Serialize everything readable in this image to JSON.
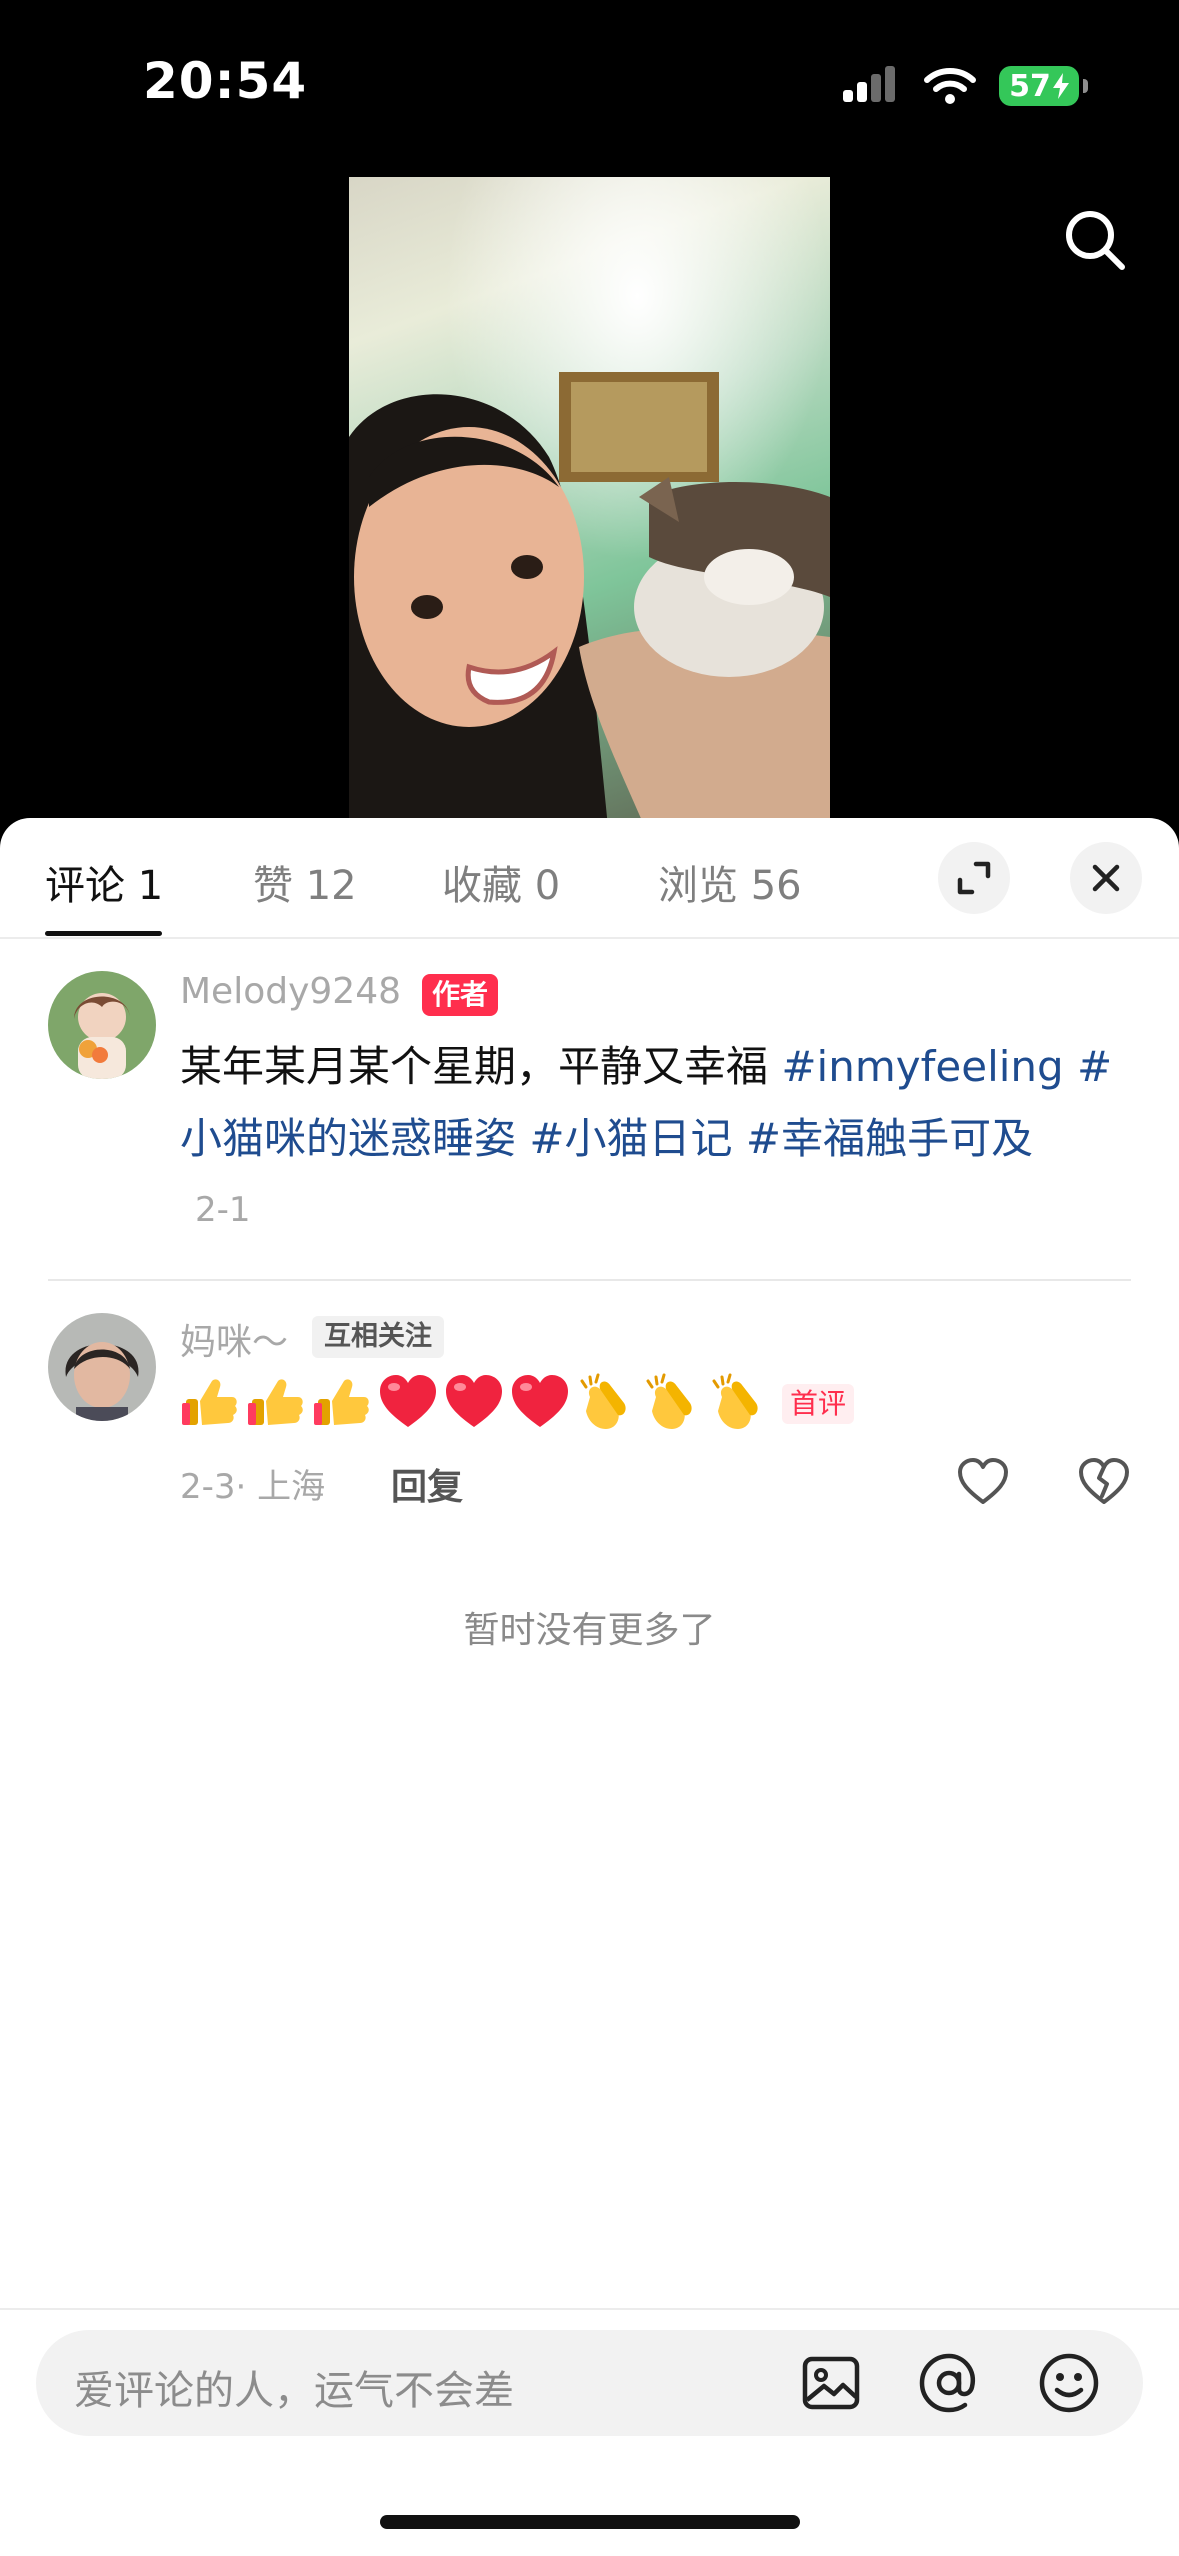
{
  "status_bar": {
    "time": "20:54",
    "battery": "57"
  },
  "tabs": [
    {
      "label": "评论 1"
    },
    {
      "label": "赞 12"
    },
    {
      "label": "收藏 0"
    },
    {
      "label": "浏览 56"
    }
  ],
  "comments": [
    {
      "username": "Melody9248",
      "badge": "作者",
      "text_plain": "某年某月某个星期，平静又幸福 ",
      "hashtags": [
        "#inmyfeeling #",
        "小猫咪的迷惑睡姿 ",
        "#小猫日记 ",
        "#幸福触手可及"
      ],
      "date": "2-1"
    },
    {
      "username": "妈咪～",
      "badge": "互相关注",
      "first_badge": "首评",
      "emojis": [
        "thumbs-up",
        "thumbs-up",
        "thumbs-up",
        "heart",
        "heart",
        "heart",
        "clap",
        "clap",
        "clap"
      ],
      "date": "2-3· 上海",
      "reply_label": "回复"
    }
  ],
  "no_more": "暂时没有更多了",
  "input": {
    "placeholder": "爱评论的人，运气不会差"
  },
  "colors": {
    "accent": "#ff2e4d",
    "hashtag": "#1f4c8f",
    "battery": "#34c759"
  }
}
